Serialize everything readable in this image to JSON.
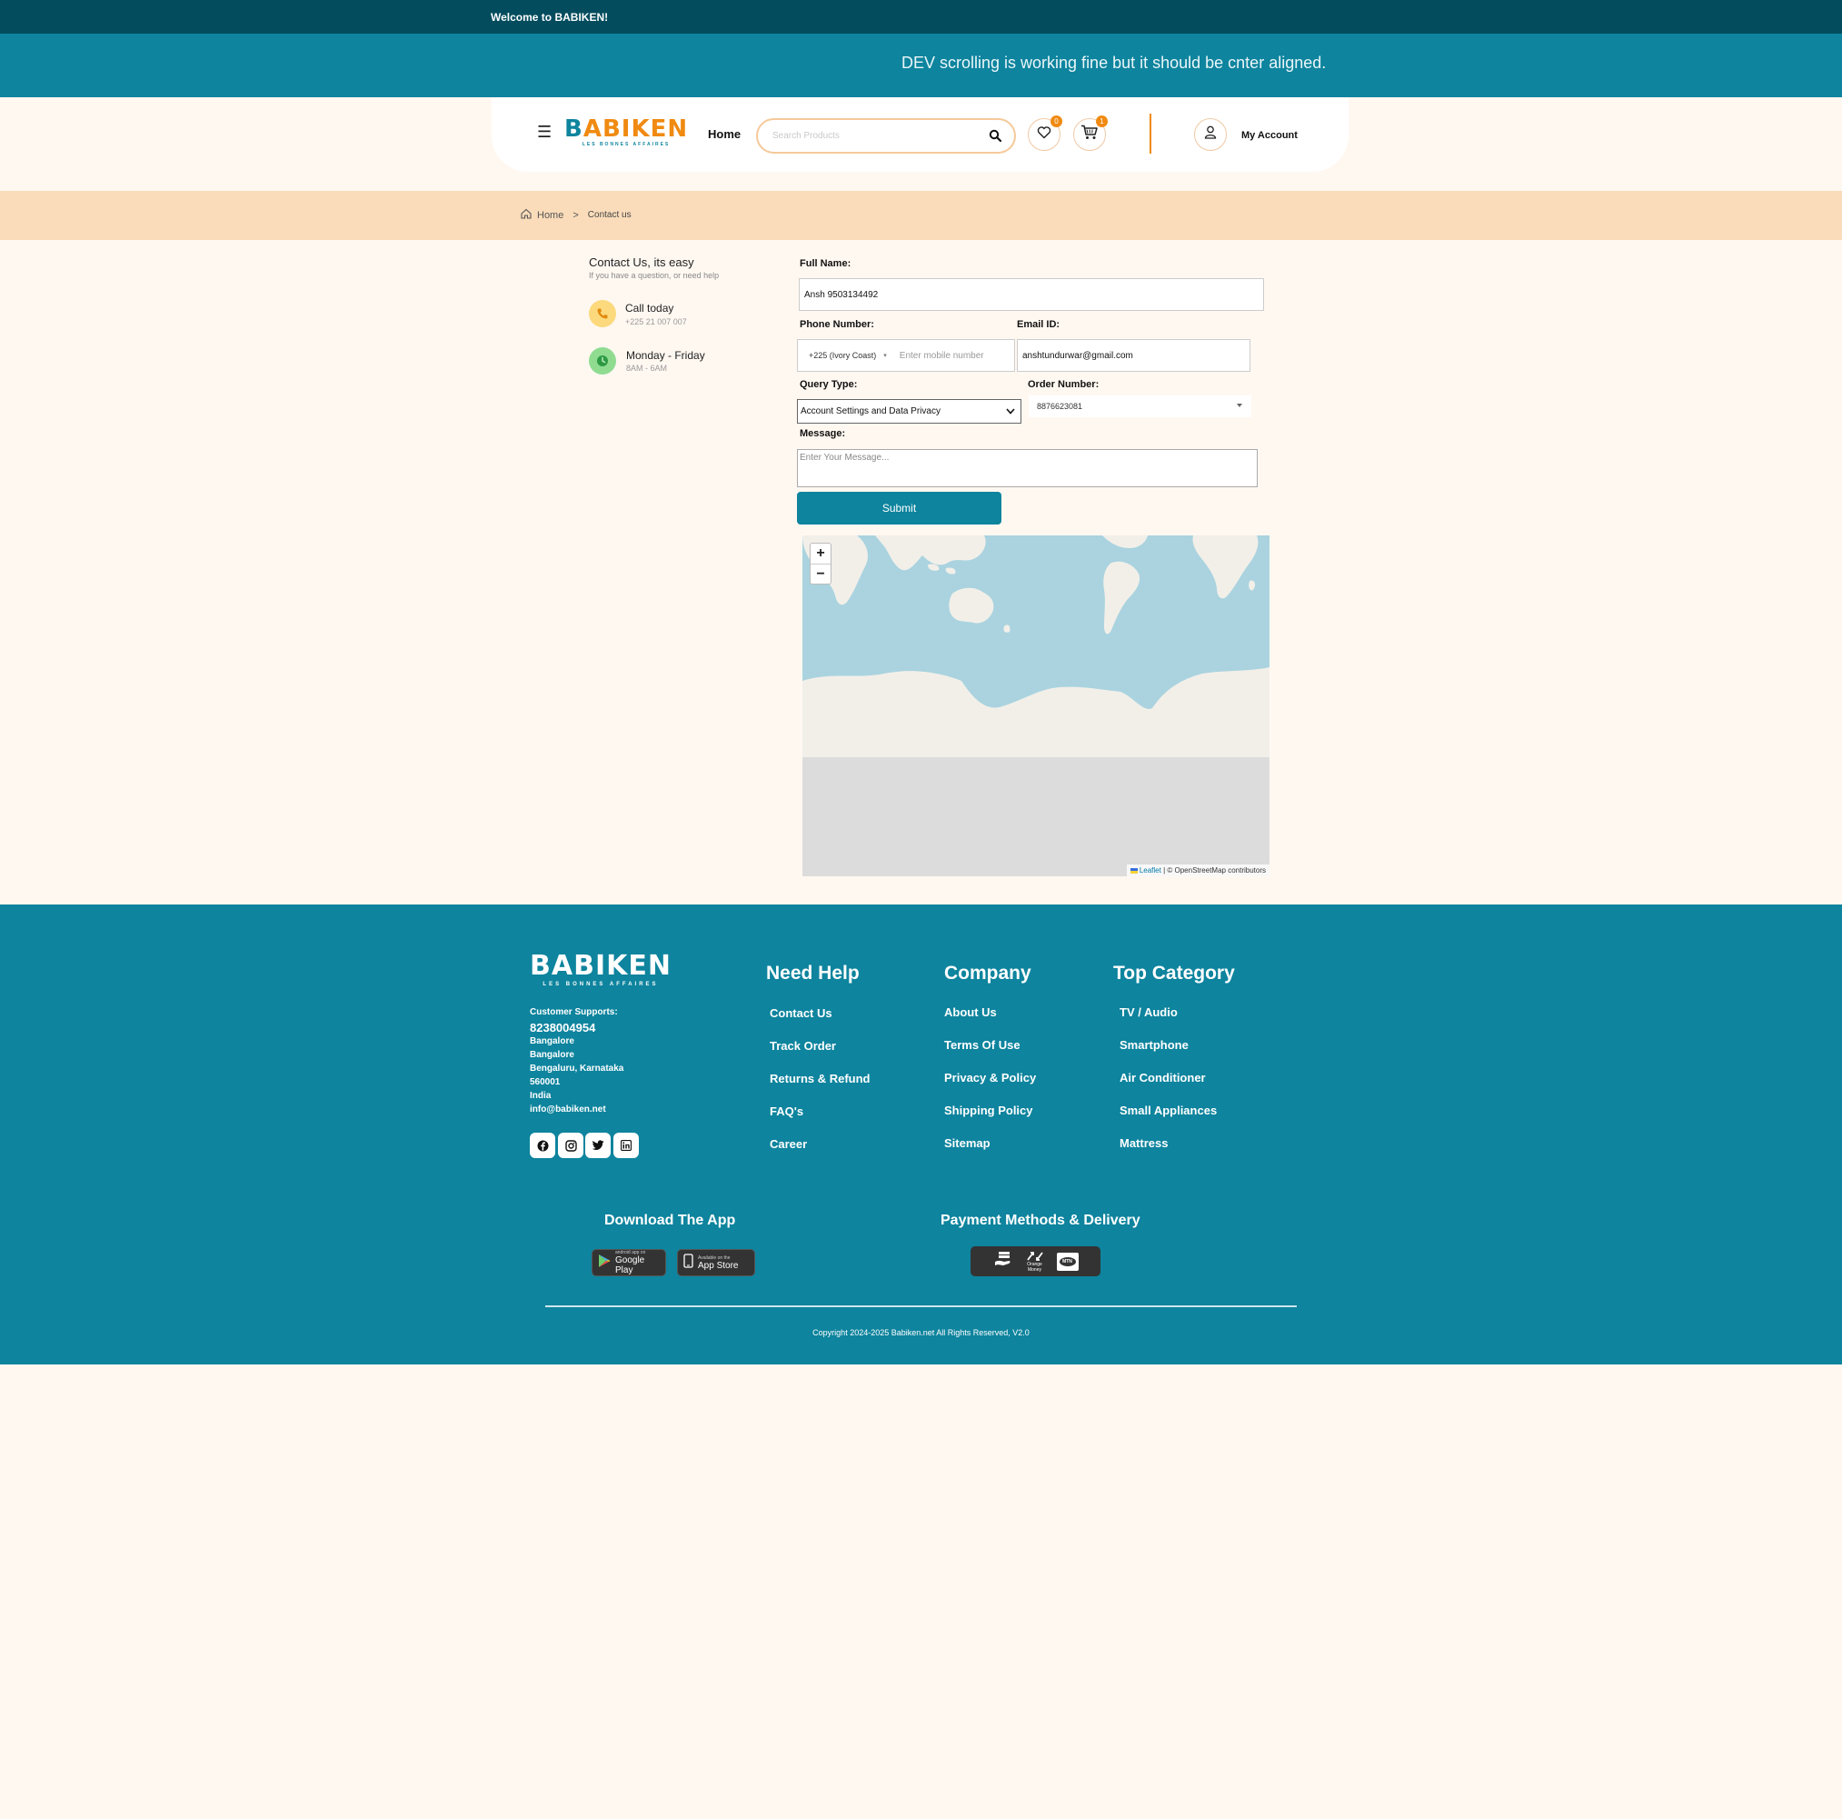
{
  "topbar": {
    "welcome": "Welcome to BABIKEN!"
  },
  "announcement": {
    "text": "DEV scrolling is working fine but it should be cnter aligned."
  },
  "header": {
    "logo_text": "BABIKEN",
    "logo_tagline": "LES BONNES AFFAIRES",
    "nav_home": "Home",
    "search_placeholder": "Search Products",
    "wishlist_count": "0",
    "cart_count": "1",
    "account_label": "My Account"
  },
  "breadcrumb": {
    "home": "Home",
    "separator": ">",
    "current": "Contact us"
  },
  "contact_info": {
    "title": "Contact Us, its easy",
    "subtitle": "If you have a question, or need help",
    "call_label": "Call today",
    "call_number": "+225 21 007 007",
    "hours_label": "Monday - Friday",
    "hours_value": "8AM - 6AM"
  },
  "form": {
    "full_name_label": "Full Name:",
    "full_name_value": "Ansh 9503134492",
    "phone_label": "Phone Number:",
    "phone_country": "+225 (Ivory Coast)",
    "phone_placeholder": "Enter mobile number",
    "email_label": "Email ID:",
    "email_value": "anshtundurwar@gmail.com",
    "query_label": "Query Type:",
    "query_value": "Account Settings and Data Privacy",
    "order_label": "Order Number:",
    "order_value": "8876623081",
    "message_label": "Message:",
    "message_placeholder": "Enter Your Message...",
    "submit_label": "Submit"
  },
  "map": {
    "zoom_in": "+",
    "zoom_out": "−",
    "attribution_leaflet": "Leaflet",
    "attribution_rest": " | © OpenStreetMap contributors",
    "colors": {
      "ocean": "#aad3df",
      "land": "#f2efe9",
      "empty": "#dcdcdc"
    }
  },
  "footer": {
    "logo_text": "BABIKEN",
    "logo_tagline": "LES BONNES AFFAIRES",
    "support_label": "Customer Supports:",
    "support_phone": "8238004954",
    "address": [
      "Bangalore",
      "Bangalore",
      "Bengaluru, Karnataka",
      "560001",
      "India",
      "info@babiken.net"
    ],
    "social_icons": [
      "facebook-icon",
      "instagram-icon",
      "twitter-icon",
      "linkedin-icon"
    ],
    "need_help": {
      "title": "Need Help",
      "links": [
        "Contact Us",
        "Track Order",
        "Returns & Refund",
        "FAQ's",
        "Career"
      ]
    },
    "company": {
      "title": "Company",
      "links": [
        "About Us",
        "Terms Of Use",
        "Privacy & Policy",
        "Shipping Policy",
        "Sitemap"
      ]
    },
    "top_category": {
      "title": "Top Category",
      "links": [
        "TV / Audio",
        "Smartphone",
        "Air Conditioner",
        "Small Appliances",
        "Mattress"
      ]
    },
    "download_title": "Download The App",
    "google_play_small": "android app on",
    "google_play_big": "Google Play",
    "app_store_small": "Available on the",
    "app_store_big": "App Store",
    "payment_title": "Payment Methods & Delivery",
    "payment_orange_money": "Orange Money",
    "payment_mtn": "MTN",
    "copyright": "Copyright 2024-2025 Babiken.net All Rights Reserved, V2.0"
  },
  "colors": {
    "primary": "#0e849e",
    "dark": "#034c5e",
    "accent": "#f08a12",
    "page_bg": "#fff8f1",
    "breadcrumb_bg": "#fadcba"
  }
}
